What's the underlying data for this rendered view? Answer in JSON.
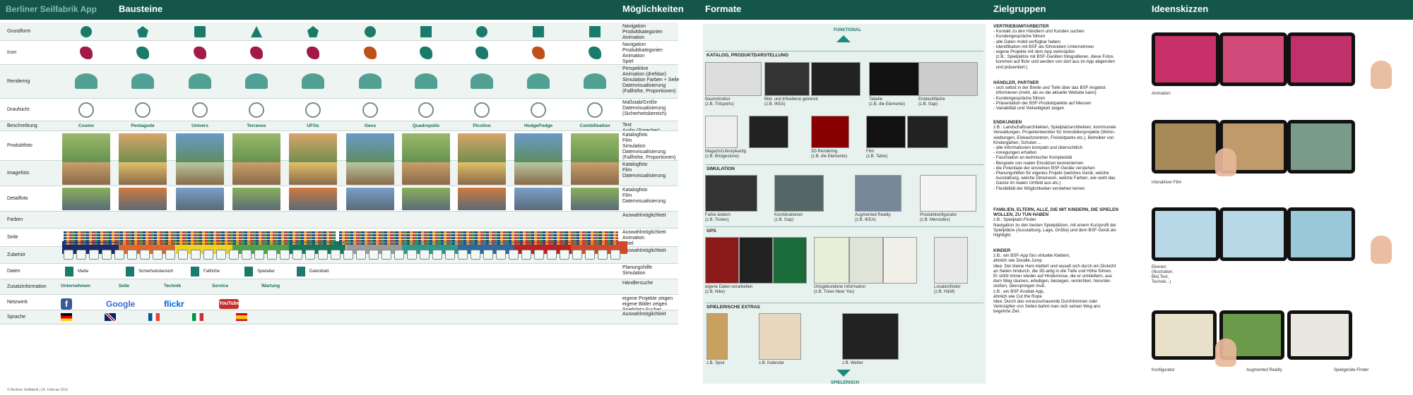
{
  "header": {
    "app": "Berliner Seilfabrik App",
    "bausteine": "Bausteine",
    "moeglichkeiten": "Möglichkeiten",
    "formate": "Formate",
    "zielgruppen": "Zielgruppen",
    "ideenskizzen": "Ideenskizzen"
  },
  "rows": [
    "Grundform",
    "Icon",
    "Rendering",
    "Draufsicht",
    "Beschreibung",
    "Produktfoto",
    "Imagefoto",
    "Detailfoto",
    "Farben",
    "Seile",
    "Zubehör",
    "Daten",
    "Zusatzinformation",
    "Netzwerk",
    "Sprache"
  ],
  "products": [
    "Cosmo",
    "Pentagode",
    "Univers",
    "Terranos",
    "UFOs",
    "Geos",
    "Quadropolis",
    "Picolino",
    "HodgePodge",
    "Combilleation"
  ],
  "possibilities": [
    "Navigation\nProduktkategorien\nAnimation\nSpiel",
    "Navigation\nProduktkategorien\nAnimation\nSpiel",
    "Perspektive\nAnimation (drehbar)\nSimulation Farben + Seile\nDatenvisualisierung\n(Fallhöhe, Proportionen)",
    "Maßstab/Größe\nDatenvisualisierung\n(Sicherheitsbereich)",
    "Text\nAudio (Sprecher)",
    "Katalogfoto\nFilm\nSimulation\nDatenvisualisierung\n(Fallhöhe, Proportionen)",
    "Katalogfoto\nFilm\nDatenvisualisierung",
    "Katalogfoto\nFilm\nDatenvisualisierung",
    "Auswahlmöglichkeit",
    "Auswahlmöglichkeit\nAnimation\nSpiel",
    "Auswahlmöglichkeit",
    "Planungshilfe\nSimulation",
    "Händlersuche",
    "eigene Projekte zeigen\neigene Bilder zeigen\nSpielplatz-Sucher\nSpielgeräte-Sucher",
    "Auswahlmöglichkeit"
  ],
  "daten": [
    "Maße",
    "Sicherheitsbereich",
    "Fallhöhe",
    "Spielalter",
    "Datenblatt"
  ],
  "zusatz": [
    "Unternehmen",
    "Seile",
    "Technik",
    "Service",
    "Wartung"
  ],
  "network": {
    "google": "Google",
    "flickr": "flickr",
    "youtube": "YouTube"
  },
  "colors": [
    "#1a2a6a",
    "#e0662a",
    "#f0d020",
    "#4aa54a",
    "#127a5a",
    "#9a9a9a",
    "#2a9a8a",
    "#2a6aa0",
    "#c02020",
    "#d04a2a"
  ],
  "footer": "© Berliner Seilfabrik | 16. Februar 2011",
  "formate": {
    "funktional": "FUNKTIONAL",
    "spielerisch": "SPIELERISCH",
    "sections": [
      "KATALOG, PRODUKTDARSTELLUNG",
      "SIMULATION",
      "GPS",
      "SPIELERISCHE EXTRAS"
    ],
    "captions": [
      "Baumstruktur\n(z.B. Tritsports)",
      "Bild- und Infoebene getrennt\n(z.B. IKEA)",
      "Tabelle\n(z.B. die Elemente)",
      "Entdeckfläche\n(z.B. Gap)",
      "Magazin/Lifestyleartig\n(z.B. Bridgestone)",
      "3D-Rendering\n(z.B. die Elemente)",
      "Film\n(z.B. Tabio)",
      "Farbe ändern\n(z.B. Tosten)",
      "Kombinationen\n(z.B. Gap)",
      "Augmented Reality\n(z.B. IKEA)",
      "Produktkonfigurator\n(z.B. Mercedes)",
      "eigene Daten verarbeiten\n(z.B. Nike)",
      "Ortsgebundene Information\n(z.B. Trees Near You)",
      "Locationfinder\n(z.B. H&M)",
      "z.B. Spiol",
      "z.B. Kalendar",
      "z.B. Wetter"
    ]
  },
  "zielgruppen": [
    {
      "title": "VERTRIEBSMITARBEITER",
      "text": "- Kontakt zu den Händlern und Kunden suchen\n- Kundengespräche führen\n- alle Daten mobil verfügbar haben\n- Identifikation mit BSF als führendem Unternehmen\n- eigene Projekte mit dem App verknüpfen\n  (z.B.: Spielplätze mit BSF-Geräten fotografieren, diese Fotos\n  kommen auf flickr und werden von dort aus im App abgerufen\n  und präsentiert.)"
    },
    {
      "title": "HÄNDLER, PARTNER",
      "text": "- sich selbst in der Breite und Tiefe über das BSF Angebot\n  informieren (mehr, als es die aktuelle Website kann)\n- Kundengespräche führen\n- Präsentation der BSF-Produktpalette auf Messen\n- Variabilität und Vielseitigkeit zeigen"
    },
    {
      "title": "ENDKUNDEN",
      "text": "z.B.: Landschaftsarchitekten, Spielplatzarchitekten, kommunale\nVerwaltungen, Projektentwickler für Immobilienprojekte (Wohn-\nsiedlungen, Einkaufszentren, Freizeitparks etc.), Betreiber von\nKindergärten, Schulen ...\n- alle Informationen kompakt und übersichtlich\n- Anregungen erhalten\n- Faszination an technischer Komplexität\n- Beispiele von realen Einsätzen kennenlernen\n- die Potentiale der einzelnen BSF-Geräte verstehen\n- Planungshilfen für eigenes Projekt (welches Gerät, welche\n  Ausstattung, welche Dimension, welche Farben, wie sieht das\n  Ganze im realen Umfeld aus etc.)\n- Flexibilität der Möglichkeiten verstehen lernen"
    },
    {
      "title": "FAMILIEN, ELTERN, ALLE, DIE MIT KINDERN, DIE SPIELEN WOLLEN, ZU TUN HABEN",
      "text": "z.B.: Spielplatz-Finder\nNavigation zu den besten Spielplätzen, mit einem Kurzprofil der\nSpielplätze (Ausstattung, Lage, Größe) und dem BSF-Gerät als\nHighlight."
    },
    {
      "title": "KINDER",
      "text": "z.B.: ein BSF-App fürs virtuelle Klettern,\nähnlich wie Doodle Jump\nIdee: Der kleine Hero klettert und wuselt sich durch ein Dickicht\nan Seilen hindurch, die 3D-artig in die Tiefe und Höhe führen.\nEr stößt immer wieder auf Hindernisse, die er umklettern, aus\ndem Weg räumen, erledigen, besiegen, vernichten, herunter-\nstoßen, überspringen muß.\nz.B.: ein BSF-Knobel-App,\nähnlich wie Cut the Rope\nIdee: Durch das vorausschauende Durchtrennen oder\nVerknüpfen von Seilen bahnt man sich seinen Weg ans\nbegehrte Ziel."
    }
  ],
  "skizzen": [
    "Animation",
    "interaktiver Film",
    "Ebenen\n(Illustration,\nBild,Text,\nTechnik...)",
    "Konfigurator",
    "Augmented Reality",
    "Spielgeräte-Finder"
  ]
}
